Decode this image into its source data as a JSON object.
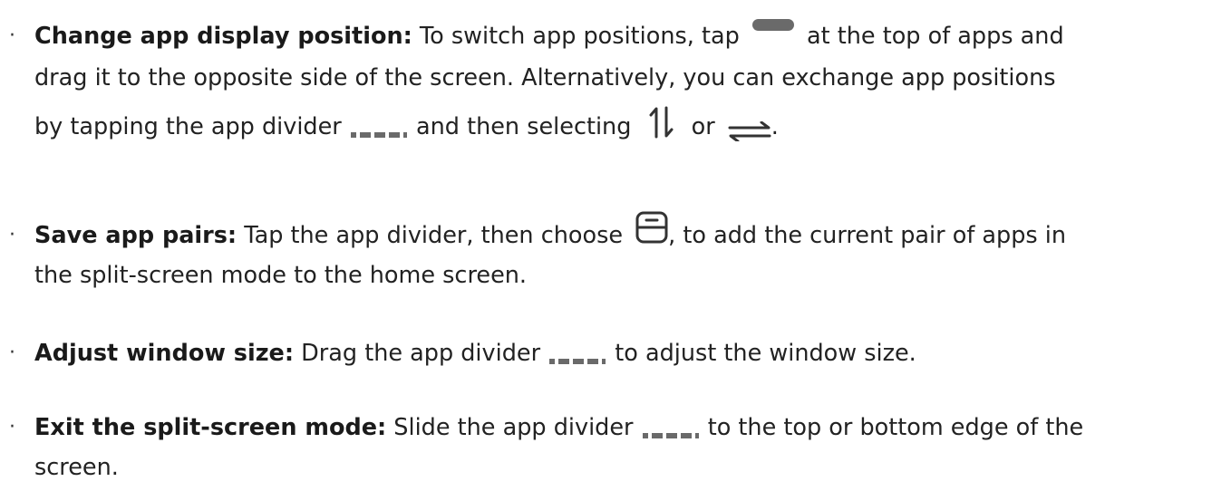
{
  "bullet_symbol": "·",
  "items": [
    {
      "title": "Change app display position:",
      "line1_a": " To switch app positions, tap ",
      "line1_b": " at the top of apps and",
      "line2": "drag it to the opposite side of the screen. Alternatively, you can exchange app positions",
      "line3_a": "by tapping the app divider ",
      "line3_b": " and then selecting ",
      "line3_c": " or ",
      "line3_d": "."
    },
    {
      "title": "Save app pairs:",
      "line1_a": " Tap the app divider, then choose ",
      "line1_b": ", to add the current pair of apps in",
      "line2": "the split-screen mode to the home screen."
    },
    {
      "title": "Adjust window size:",
      "line1_a": " Drag the app divider ",
      "line1_b": " to adjust the window size."
    },
    {
      "title": "Exit the split-screen mode:",
      "line1_a": " Slide the app divider ",
      "line1_b": " to the top or bottom edge of the",
      "line2": "screen."
    }
  ],
  "icons": {
    "pill": "drag-handle-icon",
    "divider": "app-divider-icon",
    "swap_vertical": "swap-vertical-icon",
    "swap_horizontal": "swap-horizontal-icon",
    "save_pair": "save-app-pair-icon"
  },
  "colors": {
    "text": "#222222",
    "icon": "#6a6a6a"
  }
}
